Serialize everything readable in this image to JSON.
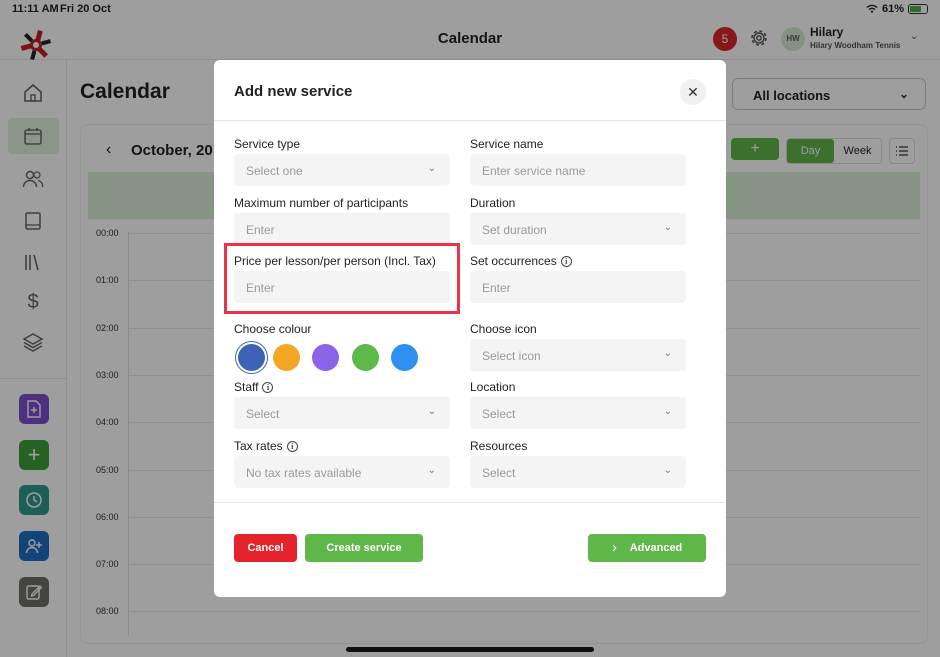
{
  "status_bar": {
    "time": "11:11 AM",
    "date": "Fri 20 Oct",
    "battery": "61%"
  },
  "header": {
    "title": "Calendar",
    "notifications_count": "5",
    "user": {
      "initials": "HW",
      "name": "Hilary",
      "club": "Hilary Woodham Tennis"
    }
  },
  "page": {
    "title": "Calendar",
    "location_select": "All locations",
    "month_label": "October, 20",
    "add_label": "+",
    "view_day": "Day",
    "view_week": "Week",
    "times": [
      "00:00",
      "01:00",
      "02:00",
      "03:00",
      "04:00",
      "05:00",
      "06:00",
      "07:00",
      "08:00"
    ]
  },
  "modal": {
    "title": "Add new service",
    "close_label": "✕",
    "fields": {
      "service_type": {
        "label": "Service type",
        "placeholder": "Select one"
      },
      "service_name": {
        "label": "Service name",
        "placeholder": "Enter service name"
      },
      "max_participants": {
        "label": "Maximum number of participants",
        "placeholder": "Enter"
      },
      "duration": {
        "label": "Duration",
        "placeholder": "Set duration"
      },
      "price": {
        "label": "Price per lesson/per person (Incl. Tax)",
        "placeholder": "Enter"
      },
      "occurrences": {
        "label": "Set occurrences",
        "placeholder": "Enter"
      },
      "colour": {
        "label": "Choose colour"
      },
      "icon": {
        "label": "Choose icon",
        "placeholder": "Select icon"
      },
      "staff": {
        "label": "Staff",
        "placeholder": "Select"
      },
      "location": {
        "label": "Location",
        "placeholder": "Select"
      },
      "tax_rates": {
        "label": "Tax rates",
        "placeholder": "No tax rates available"
      },
      "resources": {
        "label": "Resources",
        "placeholder": "Select"
      }
    },
    "colours": [
      "#3e63b4",
      "#f2a724",
      "#8a63e6",
      "#5cb94a",
      "#2e8ff0"
    ],
    "buttons": {
      "cancel": "Cancel",
      "create": "Create service",
      "advanced": "Advanced"
    }
  },
  "colors": {
    "accent_green": "#5fb749",
    "danger_red": "#e5232c",
    "highlight": "#e8334a"
  }
}
